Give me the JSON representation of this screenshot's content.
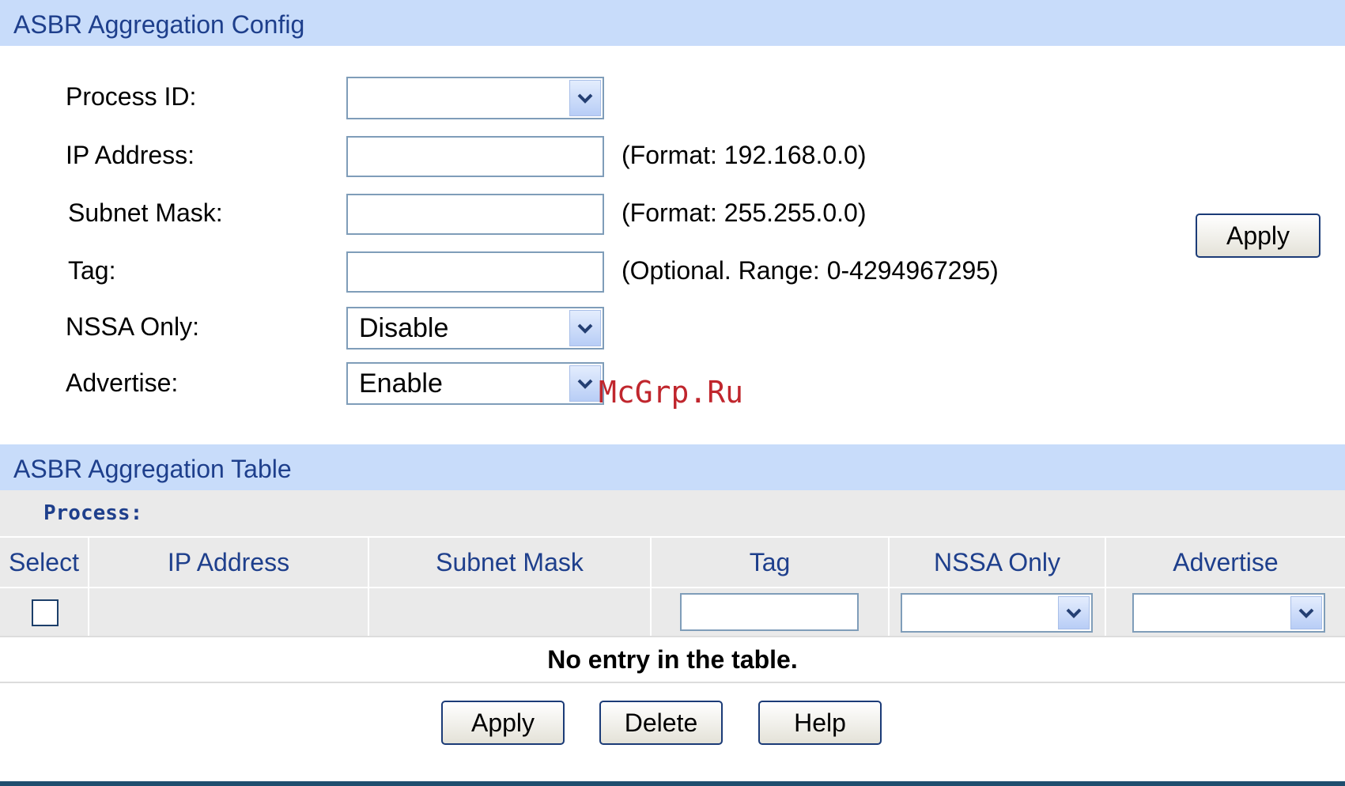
{
  "config_section": {
    "title": "ASBR Aggregation Config"
  },
  "form": {
    "process_id": {
      "label": "Process ID:",
      "value": ""
    },
    "ip_address": {
      "label": "IP Address:",
      "value": "",
      "hint": "(Format: 192.168.0.0)"
    },
    "subnet_mask": {
      "label": "Subnet Mask:",
      "value": "",
      "hint": "(Format: 255.255.0.0)"
    },
    "tag": {
      "label": "Tag:",
      "value": "",
      "hint": "(Optional. Range: 0-4294967295)"
    },
    "nssa_only": {
      "label": "NSSA Only:",
      "value": "Disable"
    },
    "advertise": {
      "label": "Advertise:",
      "value": "Enable"
    },
    "apply_label": "Apply"
  },
  "watermark": "McGrp.Ru",
  "table_section": {
    "title": "ASBR Aggregation Table",
    "process_label": "Process:",
    "columns": [
      "Select",
      "IP Address",
      "Subnet Mask",
      "Tag",
      "NSSA Only",
      "Advertise"
    ],
    "filter_row": {
      "select_checked": false,
      "tag_value": "",
      "nssa_value": "",
      "advertise_value": ""
    },
    "empty_message": "No entry in the table.",
    "buttons": {
      "apply": "Apply",
      "delete": "Delete",
      "help": "Help"
    }
  },
  "colors": {
    "header_bg": "#c8dcfa",
    "header_text": "#1e3f8c",
    "table_row_bg": "#eaeaea",
    "input_border": "#7f9db9",
    "watermark": "#c0262d",
    "bottom_rule": "#1f4e6e"
  },
  "icons": {
    "dropdown": "chevron-down-icon",
    "checkbox": "checkbox-icon"
  }
}
